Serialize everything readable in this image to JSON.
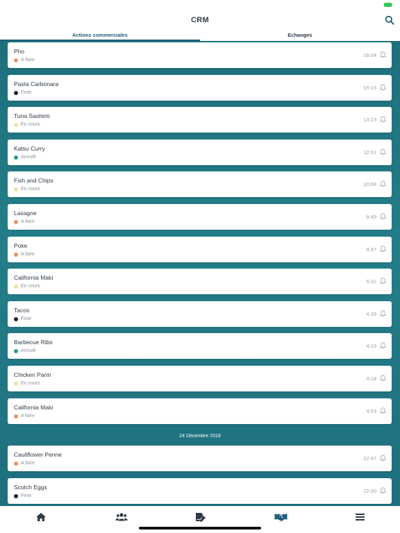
{
  "colors": {
    "accent": "#1e5e78",
    "status_afaire": "#e8916d",
    "status_finie": "#162538",
    "status_encours": "#f1e0a6",
    "status_annule": "#2a9a9b"
  },
  "header": {
    "title": "CRM",
    "search_icon": "search-icon"
  },
  "tabs": [
    {
      "label": "Actions commerciales",
      "active": true
    },
    {
      "label": "Echanges",
      "active": false
    }
  ],
  "items": [
    {
      "title": "Pho",
      "status": "A faire",
      "status_key": "afaire",
      "time": "16:04"
    },
    {
      "title": "Pasta Carbonara",
      "status": "Finie",
      "status_key": "finie",
      "time": "15:16"
    },
    {
      "title": "Tuna Sashimi",
      "status": "En cours",
      "status_key": "encours",
      "time": "13:23"
    },
    {
      "title": "Katsu Curry",
      "status": "Annulé",
      "status_key": "annule",
      "time": "12:01"
    },
    {
      "title": "Fish and Chips",
      "status": "En cours",
      "status_key": "encours",
      "time": "10:08"
    },
    {
      "title": "Lasagne",
      "status": "A faire",
      "status_key": "afaire",
      "time": "8:49"
    },
    {
      "title": "Poke",
      "status": "A faire",
      "status_key": "afaire",
      "time": "8:47"
    },
    {
      "title": "California Maki",
      "status": "En cours",
      "status_key": "encours",
      "time": "5:31"
    },
    {
      "title": "Tacos",
      "status": "Finie",
      "status_key": "finie",
      "time": "4:39"
    },
    {
      "title": "Barbecue Ribs",
      "status": "Annulé",
      "status_key": "annule",
      "time": "4:19"
    },
    {
      "title": "Chicken Parm",
      "status": "En cours",
      "status_key": "encours",
      "time": "4:18"
    },
    {
      "title": "California Maki",
      "status": "A faire",
      "status_key": "afaire",
      "time": "4:03"
    }
  ],
  "date_separator": "24 Décembre 2018",
  "items_after": [
    {
      "title": "Cauliflower Penne",
      "status": "A faire",
      "status_key": "afaire",
      "time": "22:47"
    },
    {
      "title": "Scotch Eggs",
      "status": "Finie",
      "status_key": "finie",
      "time": "22:00"
    }
  ],
  "tab_bar": [
    {
      "icon": "home-icon"
    },
    {
      "icon": "users-icon"
    },
    {
      "icon": "signature-icon"
    },
    {
      "icon": "handshake-icon",
      "active": true
    },
    {
      "icon": "menu-icon"
    }
  ]
}
